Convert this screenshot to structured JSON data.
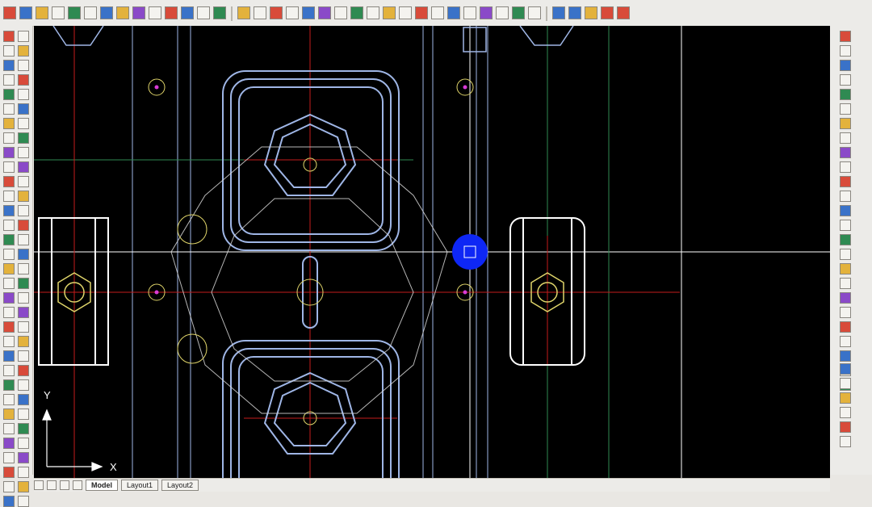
{
  "layout_tabs": {
    "items": [
      "Model",
      "Layout1",
      "Layout2"
    ]
  },
  "ucs_icon": {
    "x_label": "X",
    "y_label": "Y"
  },
  "icons": {
    "top_toolbar": [
      "new-icon",
      "open-icon",
      "save-icon",
      "print-icon",
      "cut-icon",
      "copy-icon",
      "paste-icon",
      "undo-icon",
      "redo-icon",
      "pan-icon",
      "zoom-icon",
      "line-icon",
      "polyline-icon",
      "circle-icon",
      "arc-icon",
      "rectangle-icon",
      "hatch-icon",
      "text-icon",
      "dimension-icon",
      "layer-icon"
    ],
    "left_toolbar": [
      "draw-line-icon",
      "draw-circle-icon",
      "move-icon",
      "rotate-icon",
      "trim-icon",
      "extend-icon",
      "offset-icon",
      "mirror-icon",
      "array-icon",
      "fillet-icon"
    ],
    "right_toolbar": [
      "properties-icon",
      "layer-manager-icon",
      "block-icon",
      "insert-icon",
      "match-props-icon",
      "measure-icon",
      "snap-icon",
      "osnap-icon",
      "grid-icon",
      "ortho-icon"
    ]
  },
  "colors": {
    "canvas_bg": "#000000",
    "geometry_white": "#ffffff",
    "geometry_blue": "#9fb6e6",
    "center_red": "#c51b1b",
    "hidden_yellow": "#e0d56a",
    "highlight_blue": "#0e27f5",
    "pick_pink": "#d93bd6"
  }
}
